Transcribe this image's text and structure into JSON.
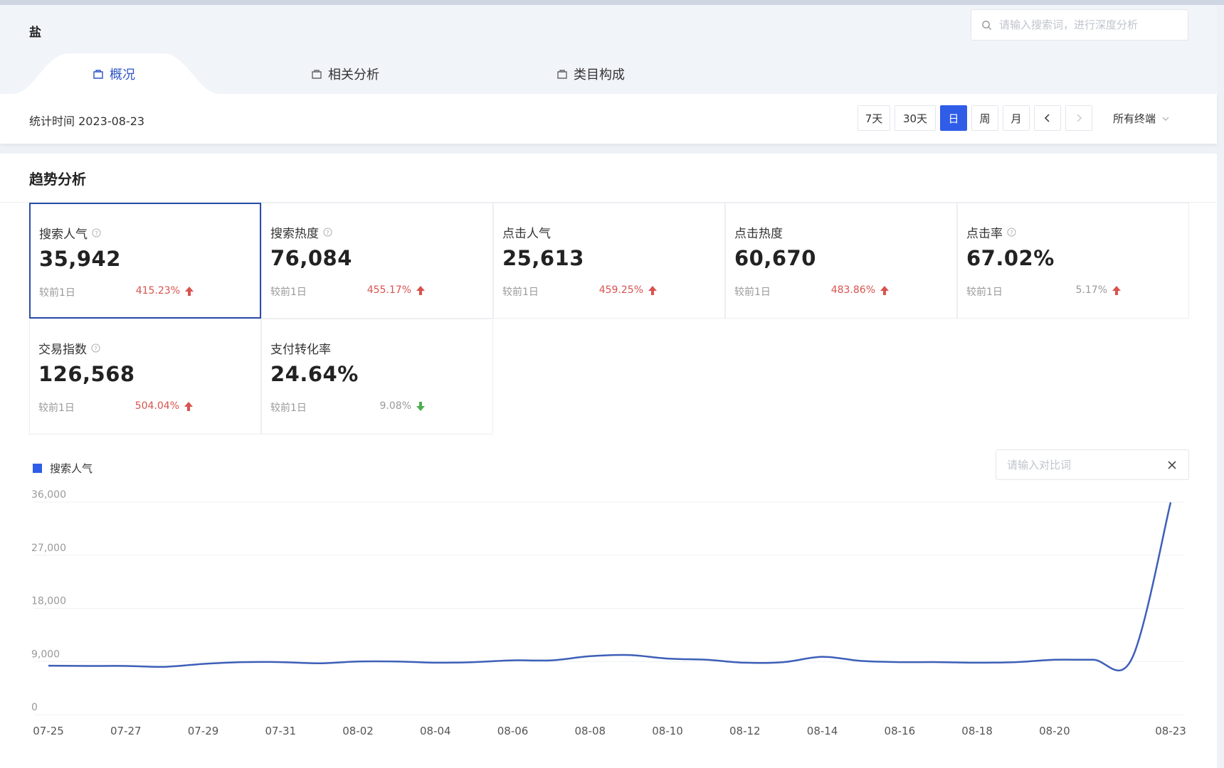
{
  "header": {
    "keyword": "盐",
    "search": {
      "placeholder": "请输入搜索词，进行深度分析",
      "value": ""
    },
    "tabs": [
      {
        "label": "概况",
        "active": true
      },
      {
        "label": "相关分析",
        "active": false
      },
      {
        "label": "类目构成",
        "active": false
      }
    ]
  },
  "filter": {
    "stat_label": "统计时间",
    "stat_date": "2023-08-23",
    "periods": [
      "7天",
      "30天",
      "日",
      "周",
      "月"
    ],
    "active_period": "日",
    "terminal": "所有终端"
  },
  "section": {
    "title": "趋势分析"
  },
  "metrics": [
    {
      "label": "搜索人气",
      "value": "35,942",
      "compare": "较前1日",
      "change": "415.23%",
      "trend": "up",
      "help": true,
      "selected": true
    },
    {
      "label": "搜索热度",
      "value": "76,084",
      "compare": "较前1日",
      "change": "455.17%",
      "trend": "up",
      "help": true
    },
    {
      "label": "点击人气",
      "value": "25,613",
      "compare": "较前1日",
      "change": "459.25%",
      "trend": "up",
      "help": false
    },
    {
      "label": "点击热度",
      "value": "60,670",
      "compare": "较前1日",
      "change": "483.86%",
      "trend": "up",
      "help": false
    },
    {
      "label": "点击率",
      "value": "67.02%",
      "compare": "较前1日",
      "change": "5.17%",
      "trend": "up",
      "help": true
    },
    {
      "label": "交易指数",
      "value": "126,568",
      "compare": "较前1日",
      "change": "504.04%",
      "trend": "up",
      "help": true
    },
    {
      "label": "支付转化率",
      "value": "24.64%",
      "compare": "较前1日",
      "change": "9.08%",
      "trend": "down",
      "help": false
    }
  ],
  "colors": {
    "accent": "#2f5de8",
    "line": "#3d5fb8",
    "up": "#d9534f",
    "down": "#4caf50"
  },
  "compare_input": {
    "placeholder": "请输入对比词"
  },
  "chart_data": {
    "type": "line",
    "legend": "搜索人气",
    "x": [
      "07-25",
      "07-26",
      "07-27",
      "07-28",
      "07-29",
      "07-30",
      "07-31",
      "08-01",
      "08-02",
      "08-03",
      "08-04",
      "08-05",
      "08-06",
      "08-07",
      "08-08",
      "08-09",
      "08-10",
      "08-11",
      "08-12",
      "08-13",
      "08-14",
      "08-15",
      "08-16",
      "08-17",
      "08-18",
      "08-19",
      "08-20",
      "08-21",
      "08-22",
      "08-23"
    ],
    "x_tick_labels": [
      "07-25",
      "07-27",
      "07-29",
      "07-31",
      "08-02",
      "08-04",
      "08-06",
      "08-08",
      "08-10",
      "08-12",
      "08-14",
      "08-16",
      "08-18",
      "08-20",
      "08-23"
    ],
    "series": [
      {
        "name": "搜索人气",
        "values": [
          8300,
          8250,
          8250,
          8100,
          8600,
          8900,
          8900,
          8700,
          9000,
          9000,
          8800,
          8900,
          9200,
          9200,
          9900,
          10100,
          9500,
          9300,
          8800,
          8900,
          9800,
          9100,
          8900,
          8900,
          8800,
          8900,
          9300,
          9300,
          9500,
          35942
        ]
      }
    ],
    "y_ticks": [
      0,
      9000,
      18000,
      27000,
      36000
    ],
    "y_tick_labels": [
      "0",
      "9,000",
      "18,000",
      "27,000",
      "36,000"
    ],
    "ylim": [
      0,
      36000
    ],
    "grid": true,
    "legend_position": "top-left"
  }
}
